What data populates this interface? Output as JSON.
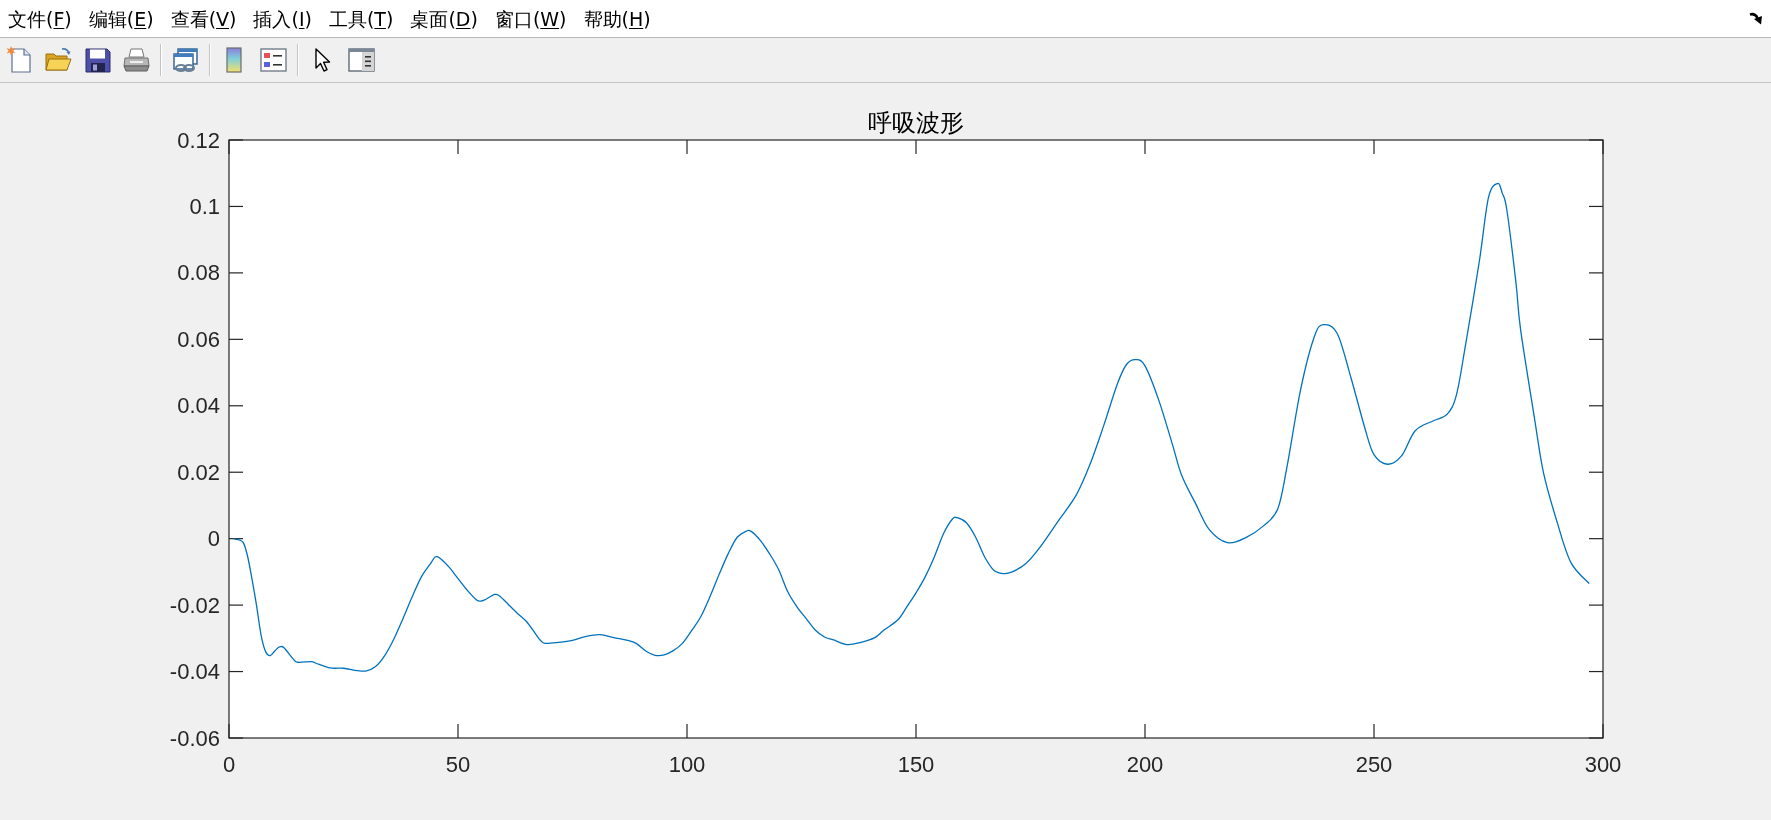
{
  "menu": [
    {
      "label_start": "文件(",
      "mnemonic": "F",
      "label_end": ")"
    },
    {
      "label_start": "编辑(",
      "mnemonic": "E",
      "label_end": ")"
    },
    {
      "label_start": "查看(",
      "mnemonic": "V",
      "label_end": ")"
    },
    {
      "label_start": "插入(",
      "mnemonic": "I",
      "label_end": ")"
    },
    {
      "label_start": "工具(",
      "mnemonic": "T",
      "label_end": ")"
    },
    {
      "label_start": "桌面(",
      "mnemonic": "D",
      "label_end": ")"
    },
    {
      "label_start": "窗口(",
      "mnemonic": "W",
      "label_end": ")"
    },
    {
      "label_start": "帮助(",
      "mnemonic": "H",
      "label_end": ")"
    }
  ],
  "axes": {
    "chart_data": {
      "type": "line",
      "title": "呼吸波形",
      "x": [
        1,
        3,
        4,
        5,
        6,
        7,
        8,
        9,
        10,
        11,
        12,
        14,
        15,
        18,
        19,
        22,
        25,
        28,
        30,
        32,
        34,
        36,
        38,
        40,
        42,
        44,
        45,
        46,
        48,
        50,
        52,
        54,
        55,
        56,
        58,
        59,
        61,
        63,
        65,
        67,
        68,
        69,
        72,
        75,
        78,
        81,
        84,
        87,
        89,
        91,
        93,
        95,
        97,
        99,
        101,
        103,
        105,
        107,
        109,
        111,
        113,
        114,
        116,
        118,
        120,
        122,
        124,
        126,
        128,
        130,
        132,
        135,
        138,
        141,
        143,
        146,
        148,
        150,
        152,
        154,
        156,
        158,
        159,
        161,
        163,
        165,
        167,
        169,
        171,
        174,
        177,
        181,
        185,
        188,
        191,
        194,
        196,
        198,
        200,
        203,
        206,
        208,
        211,
        214,
        218,
        222,
        226,
        229,
        231,
        234,
        237,
        239,
        242,
        245,
        248,
        250,
        253,
        256,
        259,
        263,
        266,
        268,
        270,
        273,
        275,
        277,
        278,
        279,
        281,
        282,
        285,
        287,
        290,
        293,
        297
      ],
      "values": [
        0,
        -0.001,
        -0.005,
        -0.012,
        -0.02,
        -0.029,
        -0.034,
        -0.0352,
        -0.0338,
        -0.0326,
        -0.0328,
        -0.0362,
        -0.0372,
        -0.037,
        -0.0375,
        -0.0389,
        -0.039,
        -0.0397,
        -0.0398,
        -0.0385,
        -0.0352,
        -0.0302,
        -0.024,
        -0.0175,
        -0.0115,
        -0.0075,
        -0.0055,
        -0.0058,
        -0.0085,
        -0.012,
        -0.0155,
        -0.0184,
        -0.0188,
        -0.0183,
        -0.0168,
        -0.0172,
        -0.0198,
        -0.0225,
        -0.025,
        -0.0288,
        -0.0306,
        -0.0315,
        -0.0312,
        -0.0306,
        -0.0294,
        -0.0289,
        -0.0298,
        -0.0306,
        -0.0316,
        -0.0338,
        -0.0351,
        -0.035,
        -0.0337,
        -0.0315,
        -0.0277,
        -0.0235,
        -0.0175,
        -0.0108,
        -0.0045,
        0.0005,
        0.0023,
        0.0022,
        -0.0005,
        -0.0045,
        -0.0093,
        -0.016,
        -0.0205,
        -0.024,
        -0.0275,
        -0.0296,
        -0.0305,
        -0.0319,
        -0.0312,
        -0.0298,
        -0.0275,
        -0.0245,
        -0.0205,
        -0.0163,
        -0.0115,
        -0.0055,
        0.0015,
        0.006,
        0.0063,
        0.0048,
        0.0005,
        -0.0055,
        -0.0095,
        -0.0105,
        -0.01,
        -0.0075,
        -0.0027,
        0.0052,
        0.0132,
        0.0224,
        0.0341,
        0.0467,
        0.0525,
        0.0539,
        0.052,
        0.0417,
        0.0283,
        0.0191,
        0.0107,
        0.0028,
        -0.0012,
        0.0003,
        0.004,
        0.009,
        0.0216,
        0.045,
        0.0609,
        0.0644,
        0.0617,
        0.0483,
        0.0333,
        0.0253,
        0.0224,
        0.0249,
        0.0325,
        0.0355,
        0.0375,
        0.0433,
        0.0584,
        0.0835,
        0.1027,
        0.1069,
        0.104,
        0.099,
        0.077,
        0.063,
        0.0366,
        0.0199,
        0.0049,
        -0.0072,
        -0.0135
      ],
      "xlim": [
        0,
        300
      ],
      "ylim": [
        -0.06,
        0.12
      ],
      "xticks": [
        0,
        50,
        100,
        150,
        200,
        250,
        300
      ],
      "yticks": [
        -0.06,
        -0.04,
        -0.02,
        0,
        0.02,
        0.04,
        0.06,
        0.08,
        0.1,
        0.12
      ]
    }
  }
}
